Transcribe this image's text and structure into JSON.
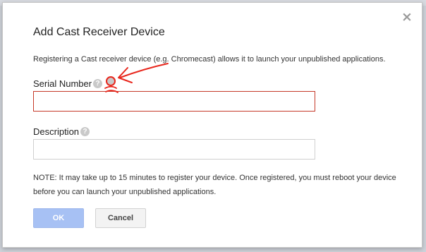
{
  "dialog": {
    "title": "Add Cast Receiver Device",
    "close_glyph": "×",
    "intro": "Registering a Cast receiver device (e.g. Chromecast) allows it to launch your unpublished applications.",
    "serial": {
      "label": "Serial Number",
      "value": "",
      "help_glyph": "?"
    },
    "description": {
      "label": "Description",
      "value": "",
      "help_glyph": "?"
    },
    "note": "NOTE: It may take up to 15 minutes to register your device. Once registered, you must reboot your device before you can launch your unpublished applications.",
    "buttons": {
      "ok": "OK",
      "cancel": "Cancel"
    }
  },
  "colors": {
    "primary_disabled": "#a7c1f4",
    "error_border": "#c53929",
    "annotation": "#e8261c"
  },
  "icons": {
    "close": "close-icon",
    "help": "help-icon",
    "annotation": "hand-drawn-arrow"
  }
}
